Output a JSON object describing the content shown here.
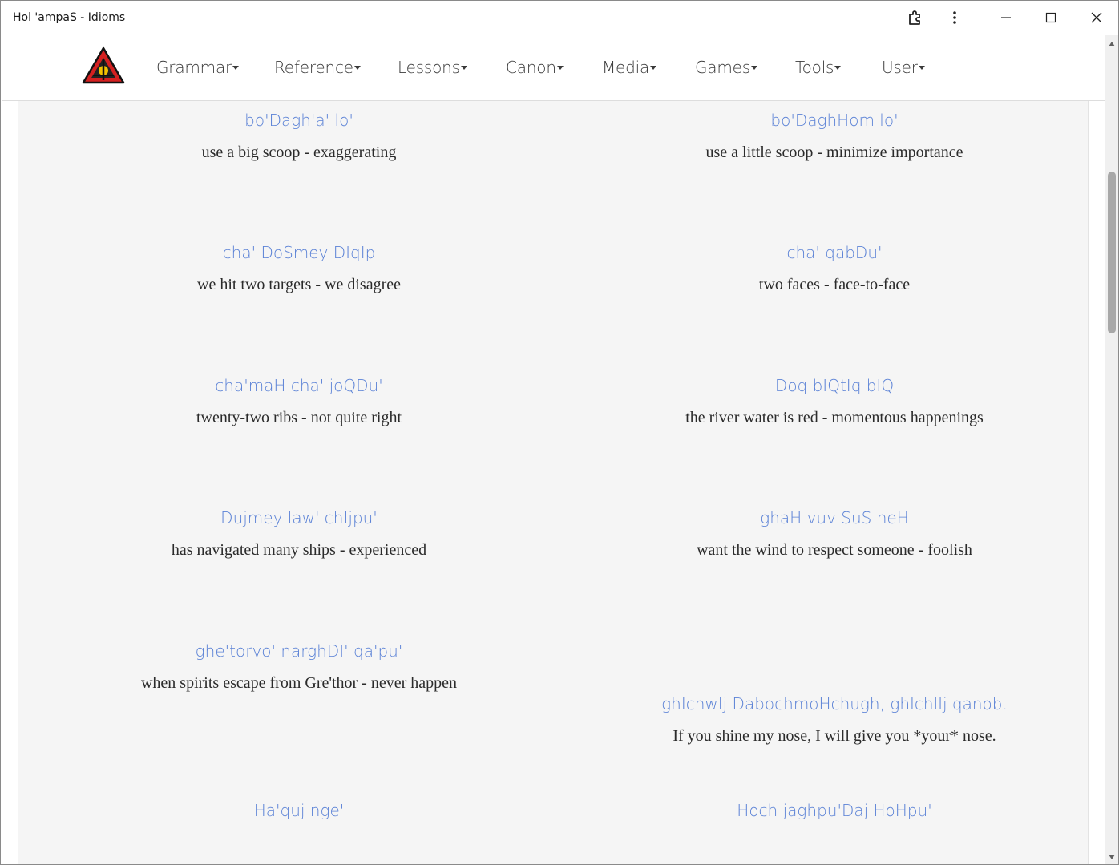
{
  "window": {
    "title": "Hol 'ampaS - Idioms",
    "controls": [
      "extensions-icon",
      "more-icon",
      "minimize-icon",
      "maximize-icon",
      "close-icon"
    ]
  },
  "nav": {
    "logo": "klingon-trefoil-logo",
    "items": [
      {
        "label": "Grammar"
      },
      {
        "label": "Reference"
      },
      {
        "label": "Lessons"
      },
      {
        "label": "Canon"
      },
      {
        "label": "Media"
      },
      {
        "label": "Games"
      },
      {
        "label": "Tools"
      },
      {
        "label": "User"
      }
    ]
  },
  "colors": {
    "pIqaD": "#f28c00",
    "latin": "#5b82d6",
    "meaning": "#2b2b2b",
    "panel": "#f5f5f5"
  },
  "idioms": [
    {
      "pIqaD": "",
      "latin": "bo'Dagh'a' lo'",
      "meaning": "use a big scoop - exaggerating"
    },
    {
      "pIqaD": "",
      "latin": "bo'DaghHom lo'",
      "meaning": "use a little scoop - minimize importance"
    },
    {
      "pIqaD": "",
      "latin": "cha' DoSmey DIqIp",
      "meaning": "we hit two targets - we disagree"
    },
    {
      "pIqaD": "",
      "latin": "cha' qabDu'",
      "meaning": "two faces - face-to-face"
    },
    {
      "pIqaD": "",
      "latin": "cha'maH cha' joQDu'",
      "meaning": "twenty-two ribs - not quite right"
    },
    {
      "pIqaD": "",
      "latin": "Doq bIQtIq bIQ",
      "meaning": "the river water is red - momentous happenings"
    },
    {
      "pIqaD": "",
      "latin": "Dujmey law' chIjpu'",
      "meaning": "has navigated many ships - experienced"
    },
    {
      "pIqaD": "",
      "latin": "ghaH vuv SuS neH",
      "meaning": "want the wind to respect someone - foolish"
    },
    {
      "pIqaD": "",
      "latin": "ghe'torvo' narghDI' qa'pu'",
      "meaning": "when spirits escape from Gre'thor - never happen"
    },
    {
      "pIqaD": "",
      "latin": "ghIchwIj DabochmoHchugh, ghIchlIj qanob.",
      "meaning": "If you shine my nose, I will give you *your* nose."
    },
    {
      "pIqaD": "",
      "latin": "Ha'quj nge'",
      "meaning": ""
    },
    {
      "pIqaD": "",
      "latin": "Hoch jaghpu'Daj HoHpu'",
      "meaning": ""
    }
  ]
}
